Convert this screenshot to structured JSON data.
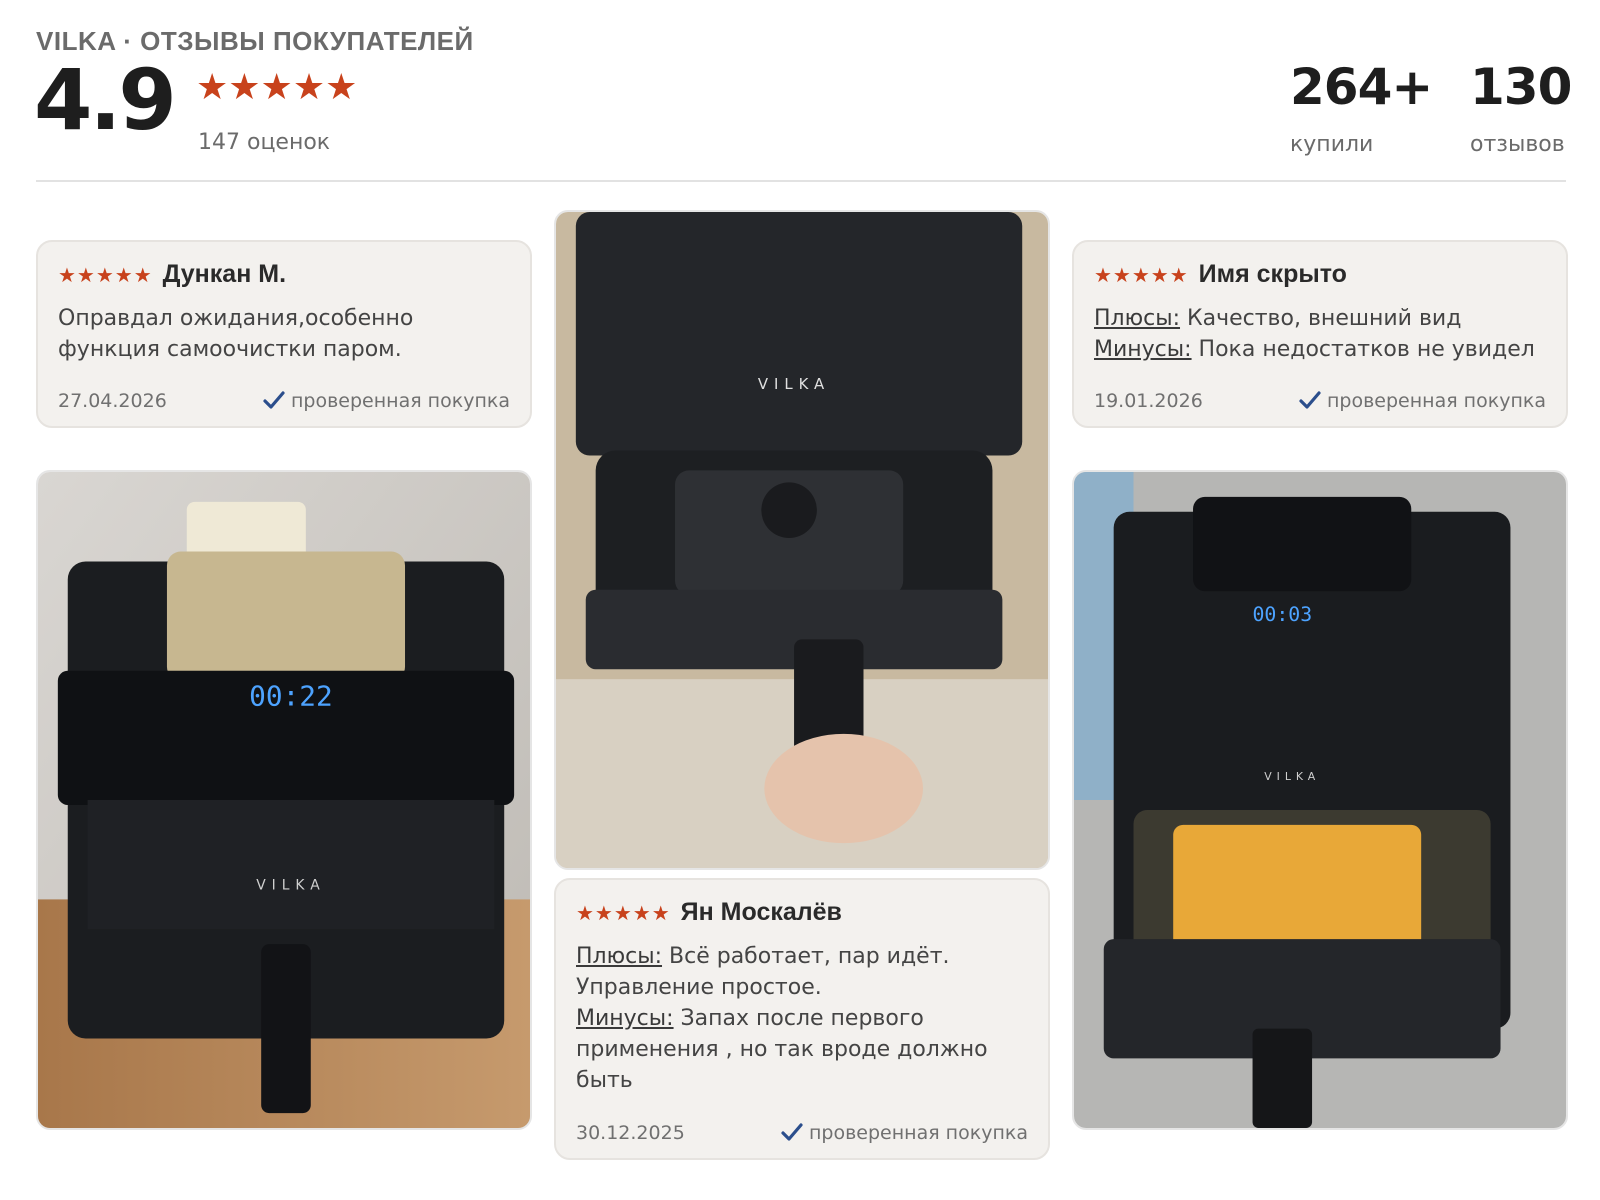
{
  "header": {
    "brand": "VILKA · ОТЗЫВЫ ПОКУПАТЕЛЕЙ",
    "rating": "4.9",
    "stars": "★★★★★",
    "ratings_count": "147 оценок",
    "stats": [
      {
        "value": "264+",
        "label": "купили"
      },
      {
        "value": "130",
        "label": "отзывов"
      }
    ]
  },
  "reviews": [
    {
      "stars": "★★★★★",
      "author": "Дункан М.",
      "text": "Оправдал ожидания,особенно функция самоочистки паром.",
      "date": "27.04.2026",
      "verified": "проверенная покупка"
    },
    {
      "stars": "★★★★★",
      "author": "Имя скрыто",
      "pros_label": "Плюсы:",
      "pros": " Качество, внешний вид",
      "cons_label": "Минусы:",
      "cons": " Пока недостатков не увидел",
      "date": "19.01.2026",
      "verified": "проверенная покупка"
    },
    {
      "stars": "★★★★★",
      "author": "Ян Москалёв",
      "pros_label": "Плюсы:",
      "pros": " Всё работает, пар идёт. Управление простое.",
      "cons_label": "Минусы:",
      "cons": " Запах после первого применения , но так вроде должно быть",
      "date": "30.12.2025",
      "verified": "проверенная покупка"
    }
  ],
  "photos": [
    {
      "brand": "VILKA",
      "display": "00:22",
      "icon": "air-fryer-front-photo"
    },
    {
      "brand": "VILKA",
      "icon": "air-fryer-basket-photo"
    },
    {
      "brand": "VILKA",
      "display": "00:03",
      "icon": "air-fryer-fries-photo"
    }
  ],
  "colors": {
    "star": "#c8421c",
    "check": "#2b4e8c",
    "card_bg": "#f3f1ee"
  }
}
